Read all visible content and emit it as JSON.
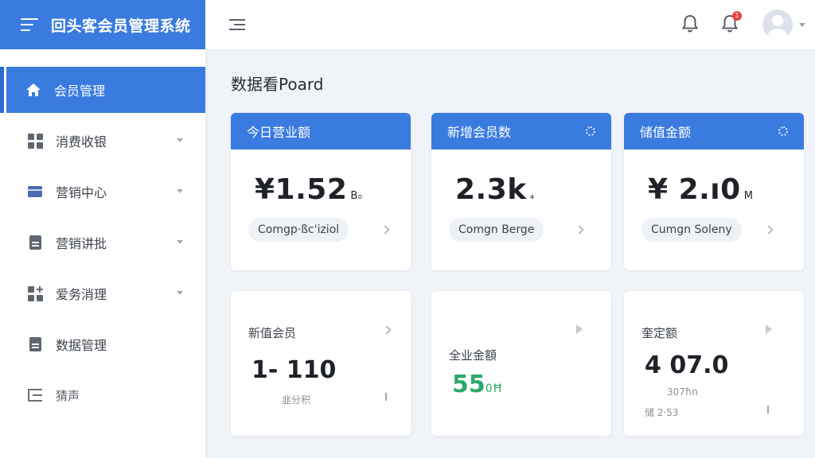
{
  "app": {
    "title": "回头客会员管理系统"
  },
  "sidebar": {
    "items": [
      {
        "label": "会员管理",
        "icon": "home-icon",
        "active": true
      },
      {
        "label": "消费收银",
        "icon": "grid-icon"
      },
      {
        "label": "营销中心",
        "icon": "card-icon"
      },
      {
        "label": "营销讲批",
        "icon": "document-icon"
      },
      {
        "label": "爱务消理",
        "icon": "grid-plus-icon"
      },
      {
        "label": "数据管理",
        "icon": "file-icon"
      },
      {
        "label": "猜声",
        "icon": "exit-icon"
      }
    ]
  },
  "header": {
    "notification_badge": "1"
  },
  "main": {
    "title": "数据看Poard",
    "stat_cards": [
      {
        "title": "今日营业额",
        "value": "¥1.52",
        "unit": "B₀",
        "pill": "Comgp·ßc'iziol"
      },
      {
        "title": "新增会员数",
        "value": "2.3k",
        "unit": "₄",
        "pill": "Comgn Berge"
      },
      {
        "title": "储值金额",
        "value": "¥ 2.ı0",
        "unit": "M",
        "pill": "Cumgn Soleny"
      }
    ],
    "detail_cards": [
      {
        "label": "新值会员",
        "value": "1- 110",
        "sub": "韭分积"
      },
      {
        "label": "全业金額",
        "value": "55",
        "unit": "0Ħ"
      },
      {
        "label": "奎定额",
        "value": "4 07.0",
        "sub": "307ħn",
        "sub2": "储 2·53"
      }
    ]
  },
  "colors": {
    "accent": "#3a7be0",
    "success": "#2fa86a",
    "badge": "#e54545"
  }
}
